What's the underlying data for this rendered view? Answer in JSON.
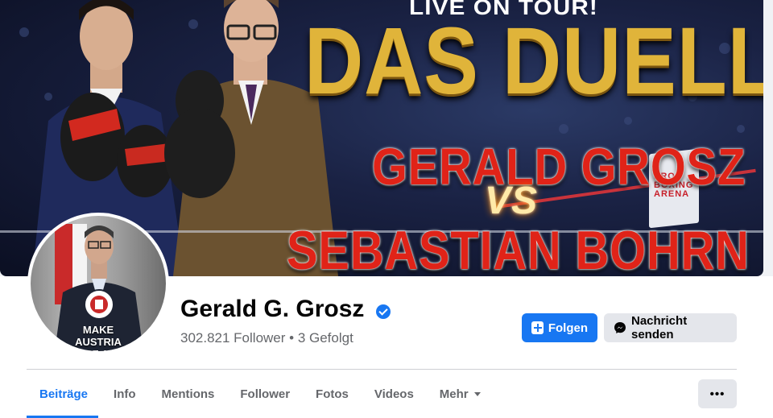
{
  "cover": {
    "headline_top": "LIVE ON TOUR!",
    "headline_main": "DAS DUELL",
    "fighter_one": "GERALD GROSZ",
    "versus": "VS",
    "fighter_two": "SEBASTIAN BOHRN MENA",
    "venue_logo": "PRO BOXING ARENA"
  },
  "profile": {
    "name": "Gerald G. Grosz",
    "verified_icon": "verified-badge-icon",
    "followers": "302.821 Follower",
    "separator": " • ",
    "following": "3 Gefolgt",
    "avatar_caption": "MAKE AUSTRIA GROSZ AGAIN"
  },
  "actions": {
    "follow_label": "Folgen",
    "follow_icon": "follow-plus-icon",
    "message_label": "Nachricht senden",
    "message_icon": "messenger-icon",
    "more_label": "•••"
  },
  "tabs": [
    {
      "label": "Beiträge",
      "active": true
    },
    {
      "label": "Info"
    },
    {
      "label": "Mentions"
    },
    {
      "label": "Follower"
    },
    {
      "label": "Fotos"
    },
    {
      "label": "Videos"
    },
    {
      "label": "Mehr"
    }
  ],
  "colors": {
    "accent": "#1877f2",
    "text_primary": "#050505",
    "text_secondary": "#65676b",
    "button_gray": "#e4e6eb"
  }
}
